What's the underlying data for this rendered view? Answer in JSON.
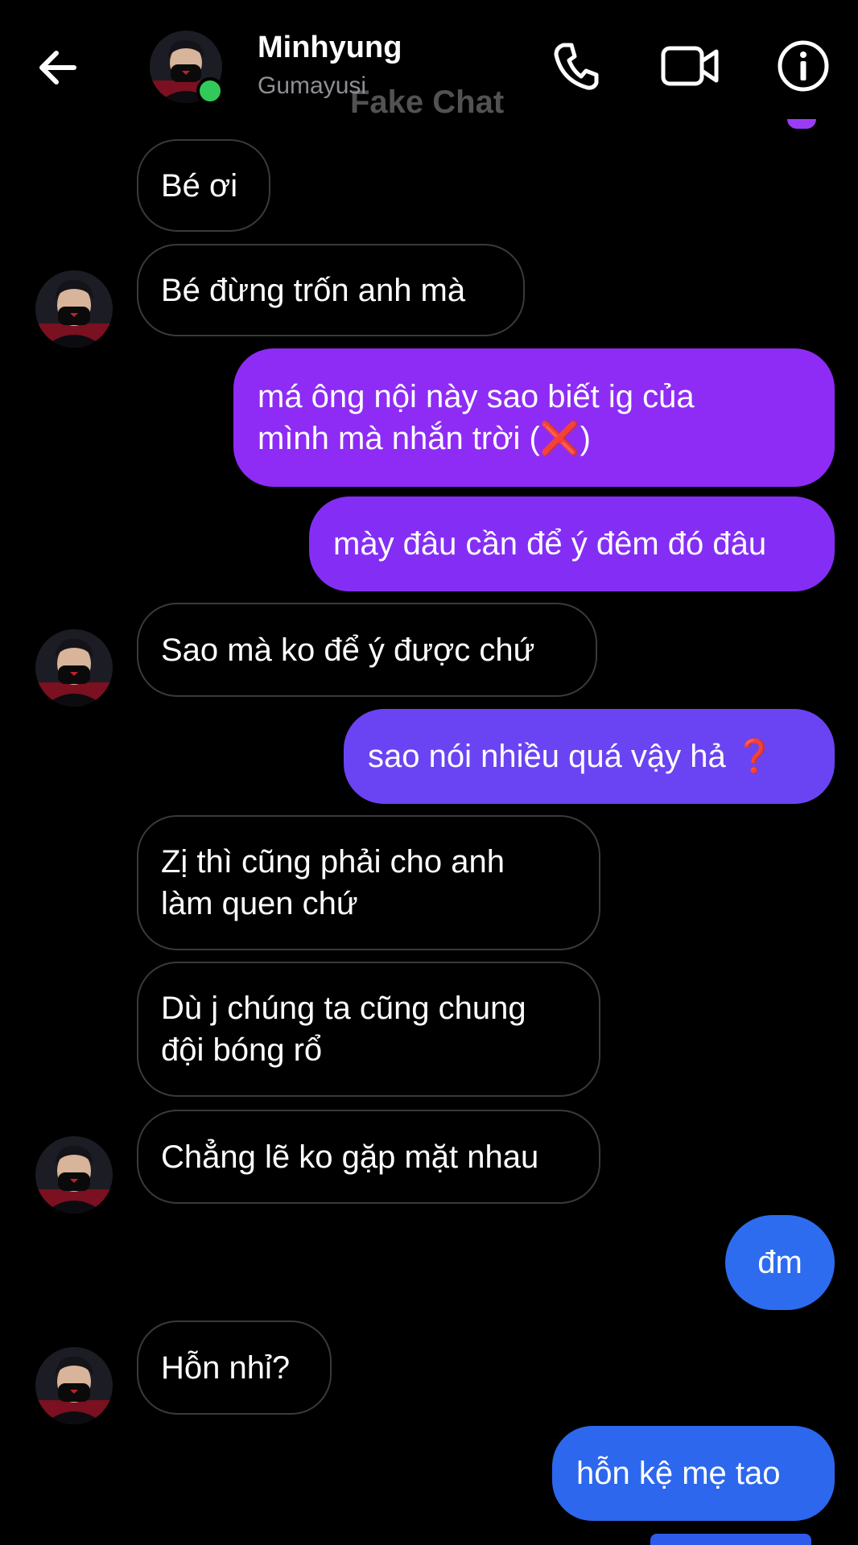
{
  "header": {
    "name": "Minhyung",
    "subtitle": "Gumayusi",
    "watermark": "Fake Chat",
    "online_color": "#31c95a",
    "icons": [
      "arrow-left-icon",
      "phone-icon",
      "video-camera-icon",
      "info-icon"
    ]
  },
  "colors": {
    "background": "#000000",
    "incoming_border": "#3a3a3c",
    "outgoing_purple": "#8e2cf6",
    "outgoing_violet": "#6a44f2",
    "outgoing_blue": "#2d6cef"
  },
  "messages": [
    {
      "from": "them",
      "text": "Bé ơi"
    },
    {
      "from": "them",
      "text": "Bé đừng trốn anh mà"
    },
    {
      "from": "me",
      "text": "má ông nội này sao biết ig của\nmình mà nhắn trời (❌)"
    },
    {
      "from": "me",
      "text": "mày đâu cần để ý đêm đó đâu"
    },
    {
      "from": "them",
      "text": "Sao mà ko để ý được chứ"
    },
    {
      "from": "me",
      "text": "sao nói nhiều quá vậy hả ❓"
    },
    {
      "from": "them",
      "text": "Zị thì cũng phải cho anh\nlàm quen chứ"
    },
    {
      "from": "them",
      "text": "Dù j chúng ta cũng chung\nđội bóng rổ"
    },
    {
      "from": "them",
      "text": "Chẳng lẽ ko gặp mặt nhau"
    },
    {
      "from": "me",
      "text": "đm"
    },
    {
      "from": "them",
      "text": "Hỗn nhỉ?"
    },
    {
      "from": "me",
      "text": "hỗn kệ mẹ tao"
    }
  ]
}
